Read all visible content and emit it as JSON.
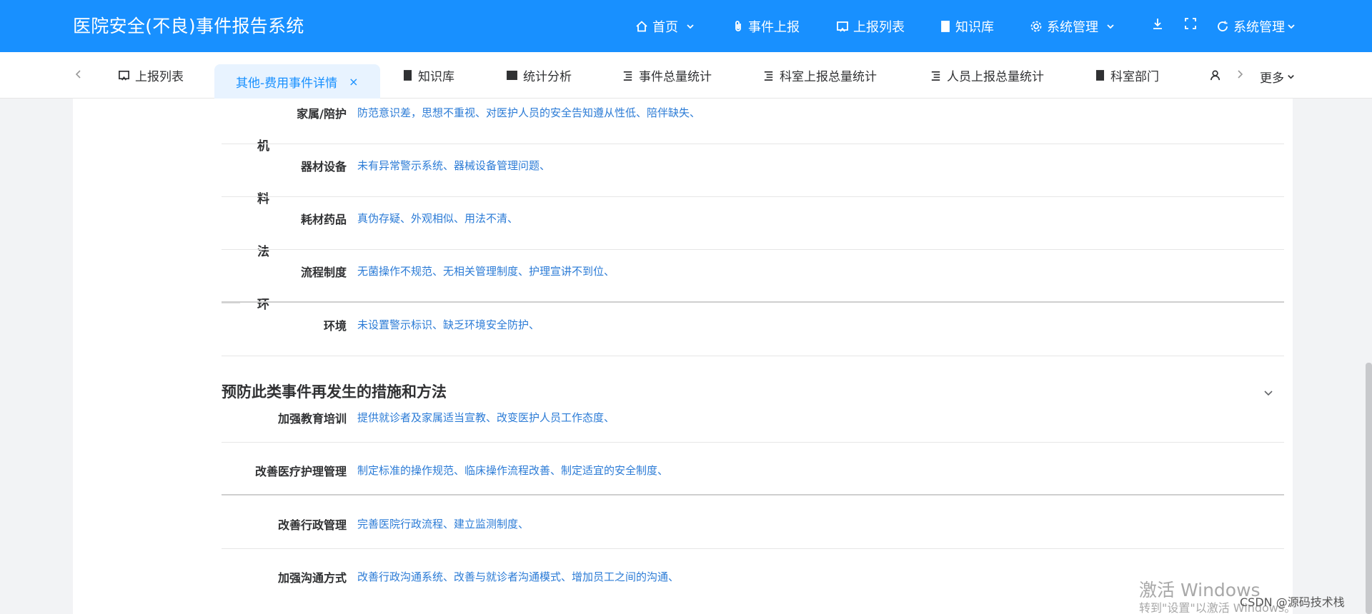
{
  "app": {
    "title": "医院安全(不良)事件报告系统"
  },
  "header_nav": {
    "home": "首页",
    "report_event": "事件上报",
    "report_list": "上报列表",
    "knowledge": "知识库",
    "system_admin": "系统管理",
    "user_menu": "系统管理"
  },
  "tabs": {
    "report_list": "上报列表",
    "detail_active": "其他-费用事件详情",
    "close": "×",
    "knowledge": "知识库",
    "stats_analysis": "统计分析",
    "event_total_stats": "事件总量统计",
    "dept_report_stats": "科室上报总量统计",
    "person_report_stats": "人员上报总量统计",
    "dept": "科室部门",
    "more": "更多"
  },
  "cause_categories": {
    "machine": "机",
    "material": "料",
    "method": "法",
    "environment": "环"
  },
  "cause_rows": [
    {
      "label": "家属/陪护",
      "value": "防范意识差，思想不重视、对医护人员的安全告知遵从性低、陪伴缺失、"
    },
    {
      "label": "器材设备",
      "value": "未有异常警示系统、器械设备管理问题、"
    },
    {
      "label": "耗材药品",
      "value": "真伪存疑、外观相似、用法不清、"
    },
    {
      "label": "流程制度",
      "value": "无菌操作不规范、无相关管理制度、护理宣讲不到位、"
    },
    {
      "label": "环境",
      "value": "未设置警示标识、缺乏环境安全防护、"
    }
  ],
  "prevention": {
    "title": "预防此类事件再发生的措施和方法",
    "rows": [
      {
        "label": "加强教育培训",
        "value": "提供就诊者及家属适当宣教、改变医护人员工作态度、"
      },
      {
        "label": "改善医疗护理管理",
        "value": "制定标准的操作规范、临床操作流程改善、制定适宜的安全制度、"
      },
      {
        "label": "改善行政管理",
        "value": "完善医院行政流程、建立监测制度、"
      },
      {
        "label": "加强沟通方式",
        "value": "改善行政沟通系统、改善与就诊者沟通模式、增加员工之间的沟通、"
      }
    ]
  },
  "watermark": {
    "line1": "激活 Windows",
    "line2": "转到\"设置\"以激活 Windows。",
    "csdn": "CSDN @源码技术栈"
  },
  "colors": {
    "header_bg": "#1890ff",
    "active_tab_bg": "#e8f3ff",
    "link_value": "#2b7bd6"
  }
}
